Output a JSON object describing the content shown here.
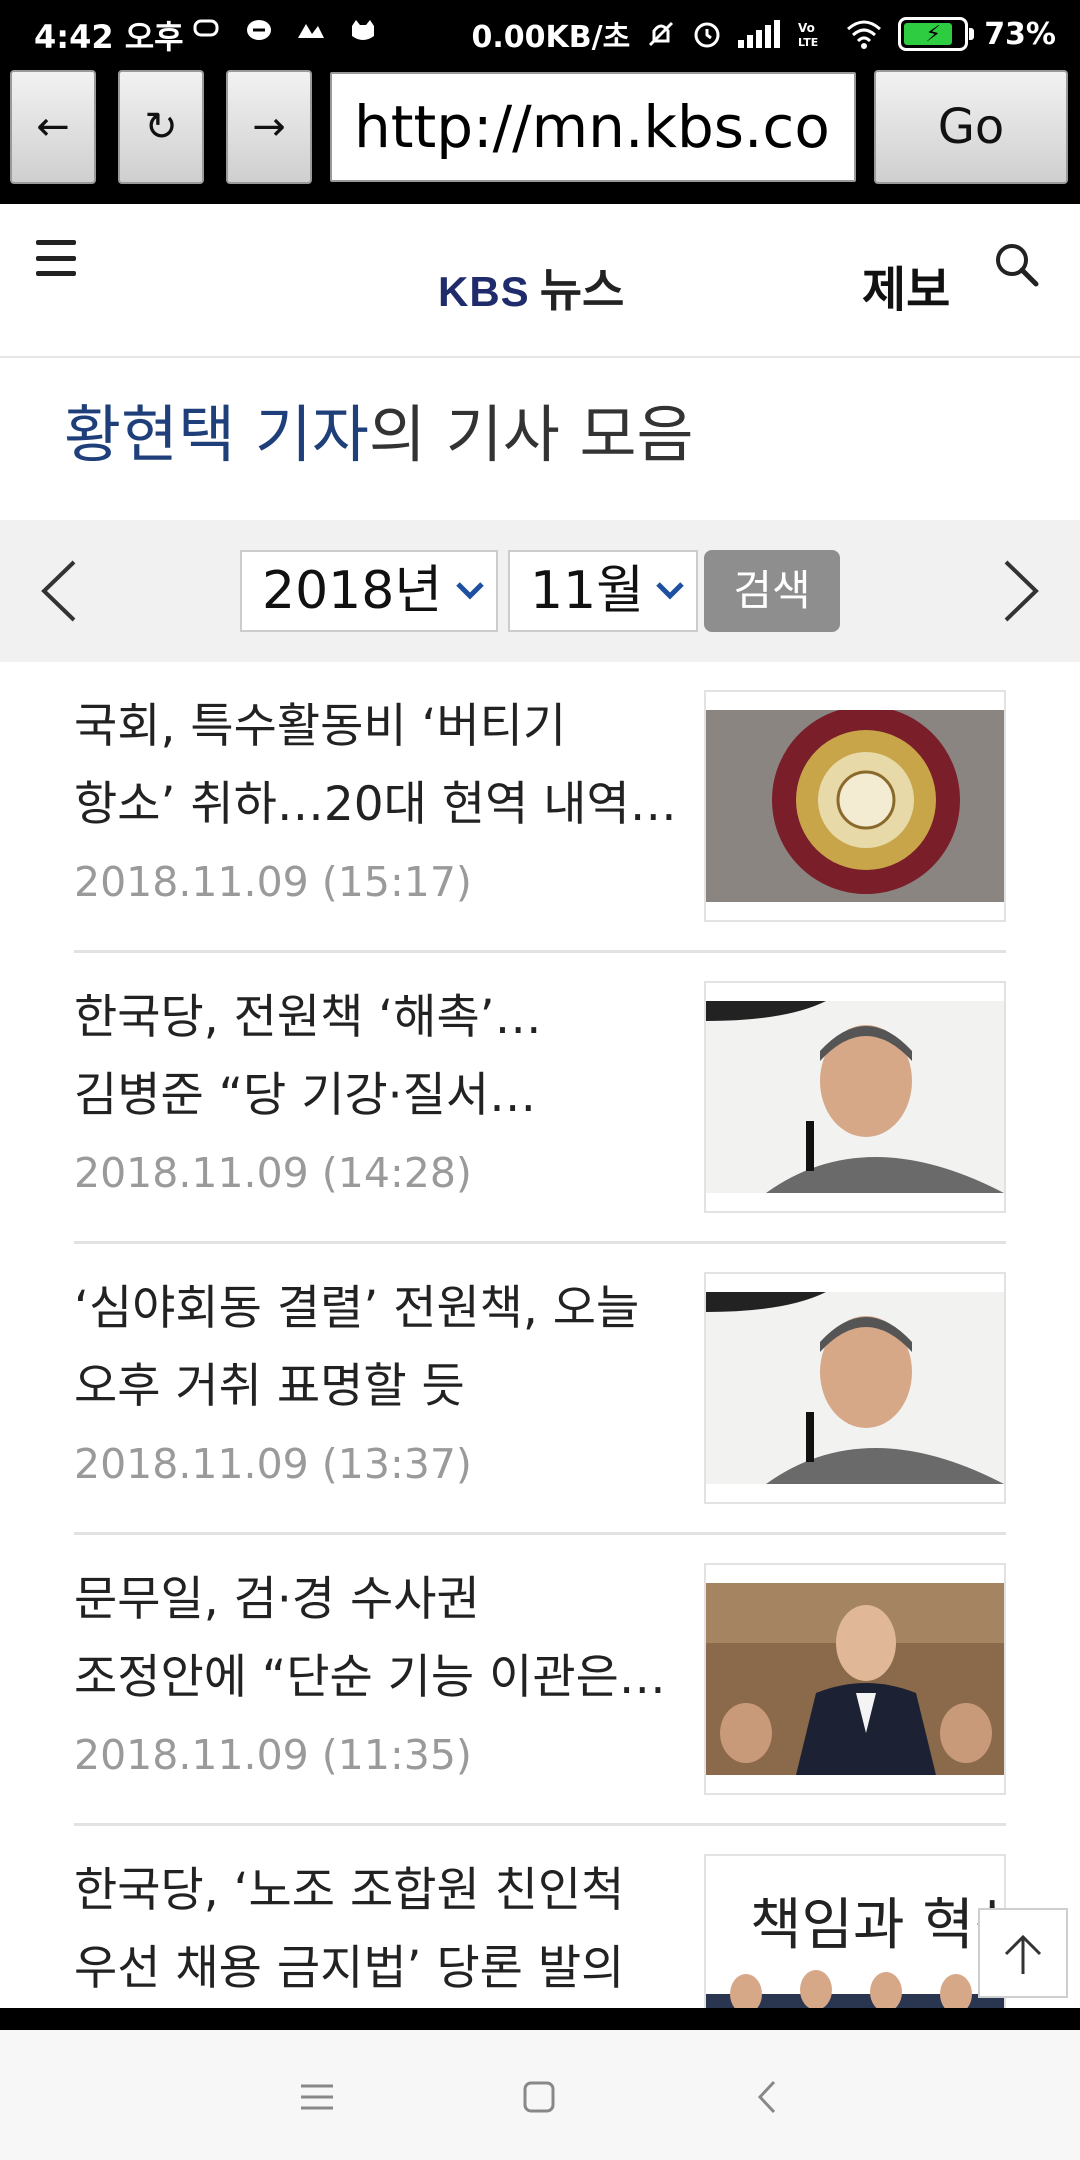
{
  "status_bar": {
    "time": "4:42 오후",
    "network_speed": "0.00KB/초",
    "battery": "73%"
  },
  "browser": {
    "back": "←",
    "reload": "↻",
    "forward": "→",
    "url": "http://mn.kbs.co",
    "go_label": "Go"
  },
  "site": {
    "logo_kbs": "KBS",
    "logo_news": "뉴스",
    "report_label": "제보"
  },
  "page": {
    "reporter_name": "황현택 기자",
    "title_suffix": "의 기사 모음"
  },
  "filter": {
    "year": "2018년",
    "month": "11월",
    "search_label": "검색"
  },
  "articles": [
    {
      "title_line1": "국회, 특수활동비 ‘버티기",
      "title_line2": "항소’ 취하…20대 현역 내역…",
      "date": "2018.11.09 (15:17)"
    },
    {
      "title_line1": "한국당, 전원책 ‘해촉’…",
      "title_line2": "김병준 “당 기강·질서…",
      "date": "2018.11.09 (14:28)"
    },
    {
      "title_line1": "‘심야회동 결렬’ 전원책, 오늘",
      "title_line2": "오후 거취 표명할 듯",
      "date": "2018.11.09 (13:37)"
    },
    {
      "title_line1": "문무일, 검·경 수사권",
      "title_line2": "조정안에 “단순 기능 이관은…",
      "date": "2018.11.09 (11:35)"
    },
    {
      "title_line1": "한국당, ‘노조 조합원 친인척",
      "title_line2": "우선 채용 금지법’ 당론 발의",
      "date": ""
    }
  ],
  "thumb_banner_text": "책임과 혁신"
}
